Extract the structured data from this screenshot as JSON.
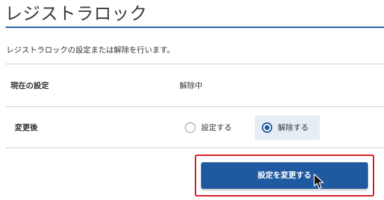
{
  "page": {
    "title": "レジストラロック",
    "description": "レジストラロックの設定または解除を行います。"
  },
  "current_setting": {
    "label": "現在の設定",
    "value": "解除中"
  },
  "change": {
    "label": "変更後",
    "options": [
      {
        "label": "設定する",
        "selected": false
      },
      {
        "label": "解除する",
        "selected": true
      }
    ]
  },
  "submit": {
    "label": "設定を変更する"
  },
  "colors": {
    "accent": "#1f5aa0",
    "highlight_border": "#d7141c",
    "selected_option_bg": "#e6edf5",
    "divider": "#c7cfd8"
  },
  "icons": {
    "cursor": "mouse-pointer-icon"
  }
}
